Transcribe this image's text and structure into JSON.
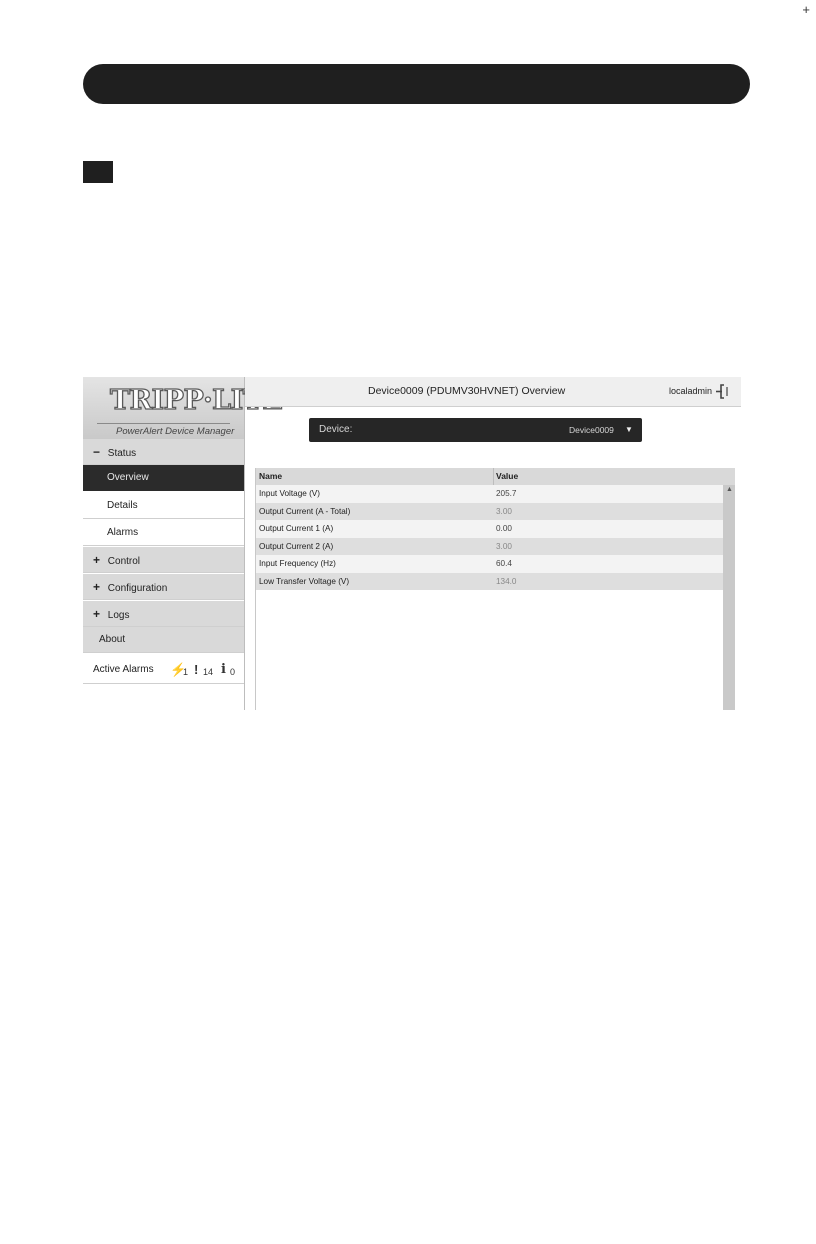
{
  "page": {
    "corner_mark": "+"
  },
  "app": {
    "logo": {
      "brand": "TRIPP·LITE",
      "subtitle": "PowerAlert Device Manager"
    },
    "header": {
      "title": "Device0009 (PDUMV30HVNET) Overview",
      "user": "localadmin",
      "logout_icon": "logout-icon"
    },
    "sidebar": {
      "items": [
        {
          "label": "Status",
          "sign": "−",
          "state": "expanded"
        },
        {
          "label": "Overview",
          "state": "selected"
        },
        {
          "label": "Details"
        },
        {
          "label": "Alarms"
        },
        {
          "label": "Control",
          "sign": "+"
        },
        {
          "label": "Configuration",
          "sign": "+"
        },
        {
          "label": "Logs",
          "sign": "+"
        },
        {
          "label": "About"
        }
      ],
      "active_alarms": {
        "label": "Active Alarms",
        "critical": {
          "icon": "lightning-icon",
          "count": "1"
        },
        "warning": {
          "icon": "exclamation-icon",
          "count": "14"
        },
        "info": {
          "icon": "info-icon",
          "count": "0"
        }
      }
    },
    "device_selector": {
      "label": "Device:",
      "value": "Device0009",
      "icon": "caret-down-icon"
    },
    "table": {
      "headers": [
        "Name",
        "Value"
      ],
      "rows": [
        {
          "name": "Input Voltage (V)",
          "value": "205.7"
        },
        {
          "name": "Output Current (A - Total)",
          "value": "3.00"
        },
        {
          "name": "Output Current 1 (A)",
          "value": "0.00"
        },
        {
          "name": "Output Current 2 (A)",
          "value": "3.00"
        },
        {
          "name": "Input Frequency (Hz)",
          "value": "60.4"
        },
        {
          "name": "Low Transfer Voltage (V)",
          "value": "134.0"
        }
      ]
    }
  }
}
